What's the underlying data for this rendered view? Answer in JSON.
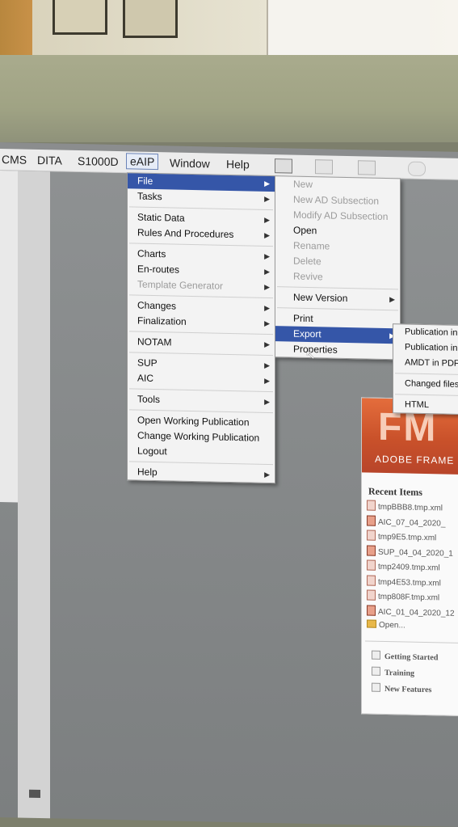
{
  "menubar": {
    "items": [
      "CMS",
      "DITA",
      "S1000D",
      "eAIP",
      "Window",
      "Help"
    ],
    "active_index": 3
  },
  "eaip_menu": {
    "groups": [
      [
        {
          "label": "File",
          "submenu": true,
          "highlighted": true
        },
        {
          "label": "Tasks",
          "submenu": true
        }
      ],
      [
        {
          "label": "Static Data",
          "submenu": true
        },
        {
          "label": "Rules And Procedures",
          "submenu": true
        }
      ],
      [
        {
          "label": "Charts",
          "submenu": true
        },
        {
          "label": "En-routes",
          "submenu": true
        },
        {
          "label": "Template Generator",
          "submenu": true,
          "disabled": true
        }
      ],
      [
        {
          "label": "Changes",
          "submenu": true
        },
        {
          "label": "Finalization",
          "submenu": true
        }
      ],
      [
        {
          "label": "NOTAM",
          "submenu": true
        }
      ],
      [
        {
          "label": "SUP",
          "submenu": true
        },
        {
          "label": "AIC",
          "submenu": true
        }
      ],
      [
        {
          "label": "Tools",
          "submenu": true
        }
      ],
      [
        {
          "label": "Open Working Publication"
        },
        {
          "label": "Change Working Publication"
        },
        {
          "label": "Logout"
        }
      ],
      [
        {
          "label": "Help",
          "submenu": true
        }
      ]
    ]
  },
  "file_menu": {
    "groups": [
      [
        {
          "label": "New",
          "disabled": true
        },
        {
          "label": "New AD Subsection",
          "disabled": true
        },
        {
          "label": "Modify AD Subsection",
          "disabled": true
        },
        {
          "label": "Open"
        },
        {
          "label": "Rename",
          "disabled": true
        },
        {
          "label": "Delete",
          "disabled": true
        },
        {
          "label": "Revive",
          "disabled": true
        }
      ],
      [
        {
          "label": "New Version",
          "submenu": true
        }
      ],
      [
        {
          "label": "Print"
        },
        {
          "label": "Export",
          "submenu": true,
          "highlighted": true
        },
        {
          "label": "Properties"
        }
      ]
    ]
  },
  "export_menu": {
    "groups": [
      [
        {
          "label": "Publication in"
        },
        {
          "label": "Publication in"
        },
        {
          "label": "AMDT in PDF"
        }
      ],
      [
        {
          "label": "Changed files"
        }
      ],
      [
        {
          "label": "HTML"
        }
      ]
    ]
  },
  "framemaker": {
    "logo": "FM",
    "tagline": "ADOBE FRAME",
    "recent_title": "Recent Items",
    "recent_items": [
      "tmpBBB8.tmp.xml",
      "AIC_07_04_2020_",
      "tmp9E5.tmp.xml",
      "SUP_04_04_2020_1",
      "tmp2409.tmp.xml",
      "tmp4E53.tmp.xml",
      "tmp808F.tmp.xml",
      "AIC_01_04_2020_12"
    ],
    "open_label": "Open...",
    "links": [
      "Getting Started",
      "Training",
      "New Features"
    ]
  },
  "colors": {
    "highlight": "#3556a8",
    "fm_banner": "#d35a30"
  }
}
